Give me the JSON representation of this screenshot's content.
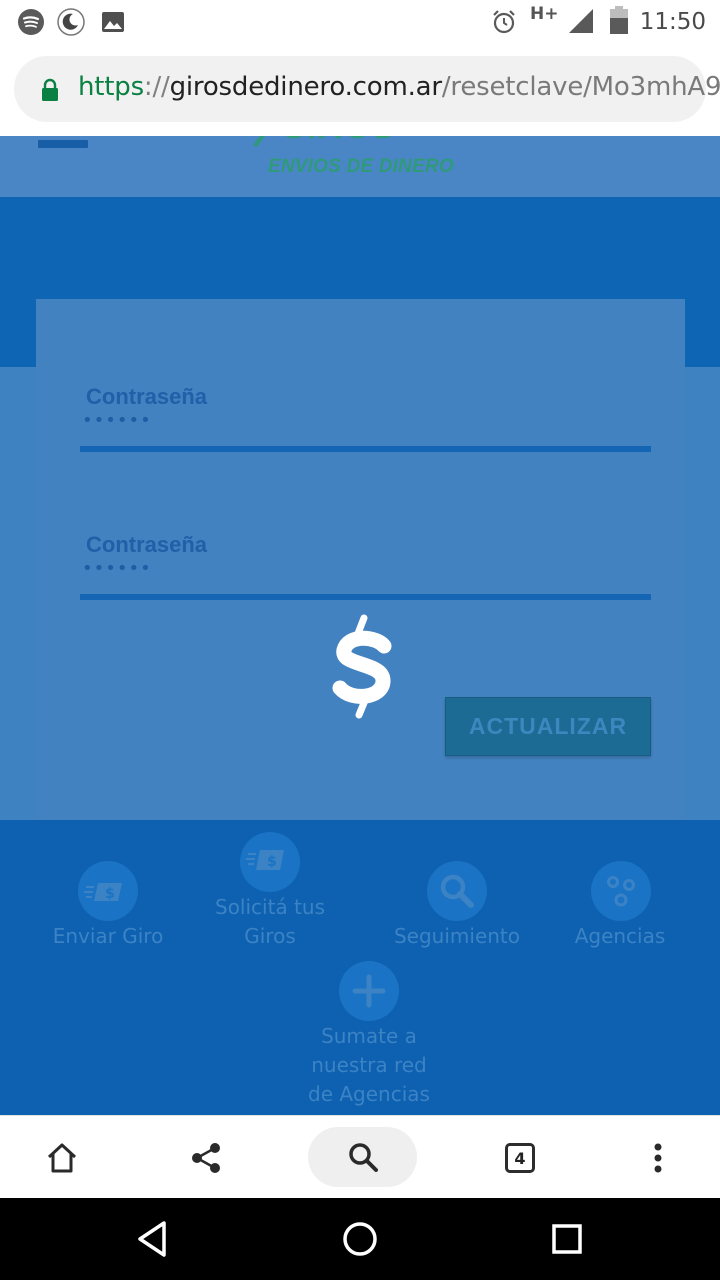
{
  "status_bar": {
    "time": "11:50",
    "network": "H+",
    "left_icons": [
      "spotify-icon",
      "night-mode-icon",
      "image-icon"
    ],
    "right_icons": [
      "alarm-icon",
      "signal-icon",
      "battery-icon"
    ]
  },
  "address_bar": {
    "scheme": "https",
    "separator": "://",
    "host": "girosdedinero.com.ar",
    "path": "/resetclave/Mo3mhA9",
    "secure": true
  },
  "header": {
    "logo_text": "GIROS",
    "logo_subtitle": "ENVIOS DE DINERO",
    "menu_icon": "hamburger-icon"
  },
  "form": {
    "fields": [
      {
        "label": "Contraseña",
        "value": "••••••"
      },
      {
        "label": "Contraseña",
        "value": "••••••"
      }
    ],
    "submit_label": "ACTUALIZAR",
    "loading_icon": "dollar-icon"
  },
  "services": [
    {
      "label": "Enviar Giro",
      "icon": "send-money-icon"
    },
    {
      "label": "Solicitá tus Giros",
      "line1": "Solicitá tus",
      "line2": "Giros",
      "icon": "request-money-icon"
    },
    {
      "label": "Seguimiento",
      "icon": "search-icon"
    },
    {
      "label": "Agencias",
      "icon": "location-icon"
    },
    {
      "label": "Sumate a nuestra red de Agencias",
      "line1": "Sumate a",
      "line2": "nuestra red",
      "line3": "de Agencias",
      "icon": "plus-icon"
    }
  ],
  "browser_toolbar": {
    "tab_count": "4",
    "icons": [
      "home-icon",
      "share-icon",
      "search-icon",
      "tabs-icon",
      "more-icon"
    ]
  },
  "nav_bar": {
    "icons": [
      "back-icon",
      "home-icon",
      "recents-icon"
    ]
  },
  "colors": {
    "page_blue": "#0e63b3",
    "overlay_blue": "#4382c0",
    "button": "#1c6b95",
    "url_green": "#0b8043"
  }
}
